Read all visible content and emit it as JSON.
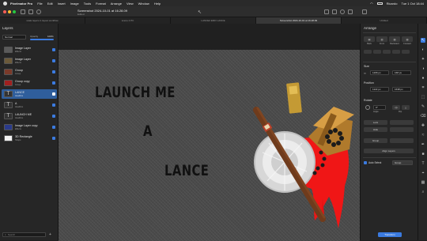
{
  "menubar": {
    "app": "Pixelmator Pro",
    "items": [
      "File",
      "Edit",
      "Insert",
      "Image",
      "Tools",
      "Format",
      "Arrange",
      "View",
      "Window",
      "Help"
    ],
    "user": "Ricardo",
    "clock": "Tue 1 Oct 18:44"
  },
  "document": {
    "title": "Screenshot 2024-10-01 at 16.28.09",
    "subtitle": "Edited"
  },
  "tabs": [
    {
      "label": "scale layers in layout workflow",
      "active": false
    },
    {
      "label": "scene 2 PC",
      "active": false
    },
    {
      "label": "LANCE2 EMO LANCE",
      "active": false
    },
    {
      "label": "Screenshot 2024-10-01 at 16.28.09",
      "active": true
    },
    {
      "label": "Untitled",
      "active": false
    }
  ],
  "layers_panel": {
    "title": "Layers",
    "blend_mode": "Normal",
    "opacity_label": "Opacity",
    "opacity_value": "100%",
    "layers": [
      {
        "name": "Image Layer",
        "sub": "Effects",
        "selected": false,
        "type": "image"
      },
      {
        "name": "Image Layer",
        "sub": "Effects",
        "selected": false,
        "type": "image"
      },
      {
        "name": "Group",
        "sub": "Group",
        "selected": false,
        "type": "group"
      },
      {
        "name": "Group copy",
        "sub": "Group",
        "selected": false,
        "type": "group"
      },
      {
        "name": "LANCE",
        "sub": "Headline",
        "selected": true,
        "type": "text"
      },
      {
        "name": "A",
        "sub": "Headline",
        "selected": false,
        "type": "text"
      },
      {
        "name": "LAUNCH ME",
        "sub": "Headline",
        "selected": false,
        "type": "text"
      },
      {
        "name": "Image Layer copy",
        "sub": "Effects",
        "selected": false,
        "type": "image"
      },
      {
        "name": "3D Rectangle",
        "sub": "Shape",
        "selected": false,
        "type": "shape"
      }
    ],
    "search_placeholder": "Search"
  },
  "canvas": {
    "line1": "LAUNCH ME",
    "line2": "A",
    "line3": "LANCE"
  },
  "inspector": {
    "title": "Arrange",
    "arrange_labels": [
      "Back",
      "Front",
      "Backward",
      "Forward"
    ],
    "size_label": "Size",
    "size_w": "1266 px",
    "size_h": "168 px",
    "position_label": "Position",
    "pos_x": "1122 px",
    "pos_y": "1638 px",
    "rotate_label": "Rotate",
    "rotate_value": "0°",
    "angle_label": "Angle",
    "flip_label": "Flip",
    "lock_btn": "Lock",
    "hide_btn": "Hide",
    "group_btn": "Group",
    "align_btn": "Align Layers",
    "auto_select_label": "Auto Select",
    "auto_select_value": "Group",
    "transform_btn": "Transform"
  }
}
